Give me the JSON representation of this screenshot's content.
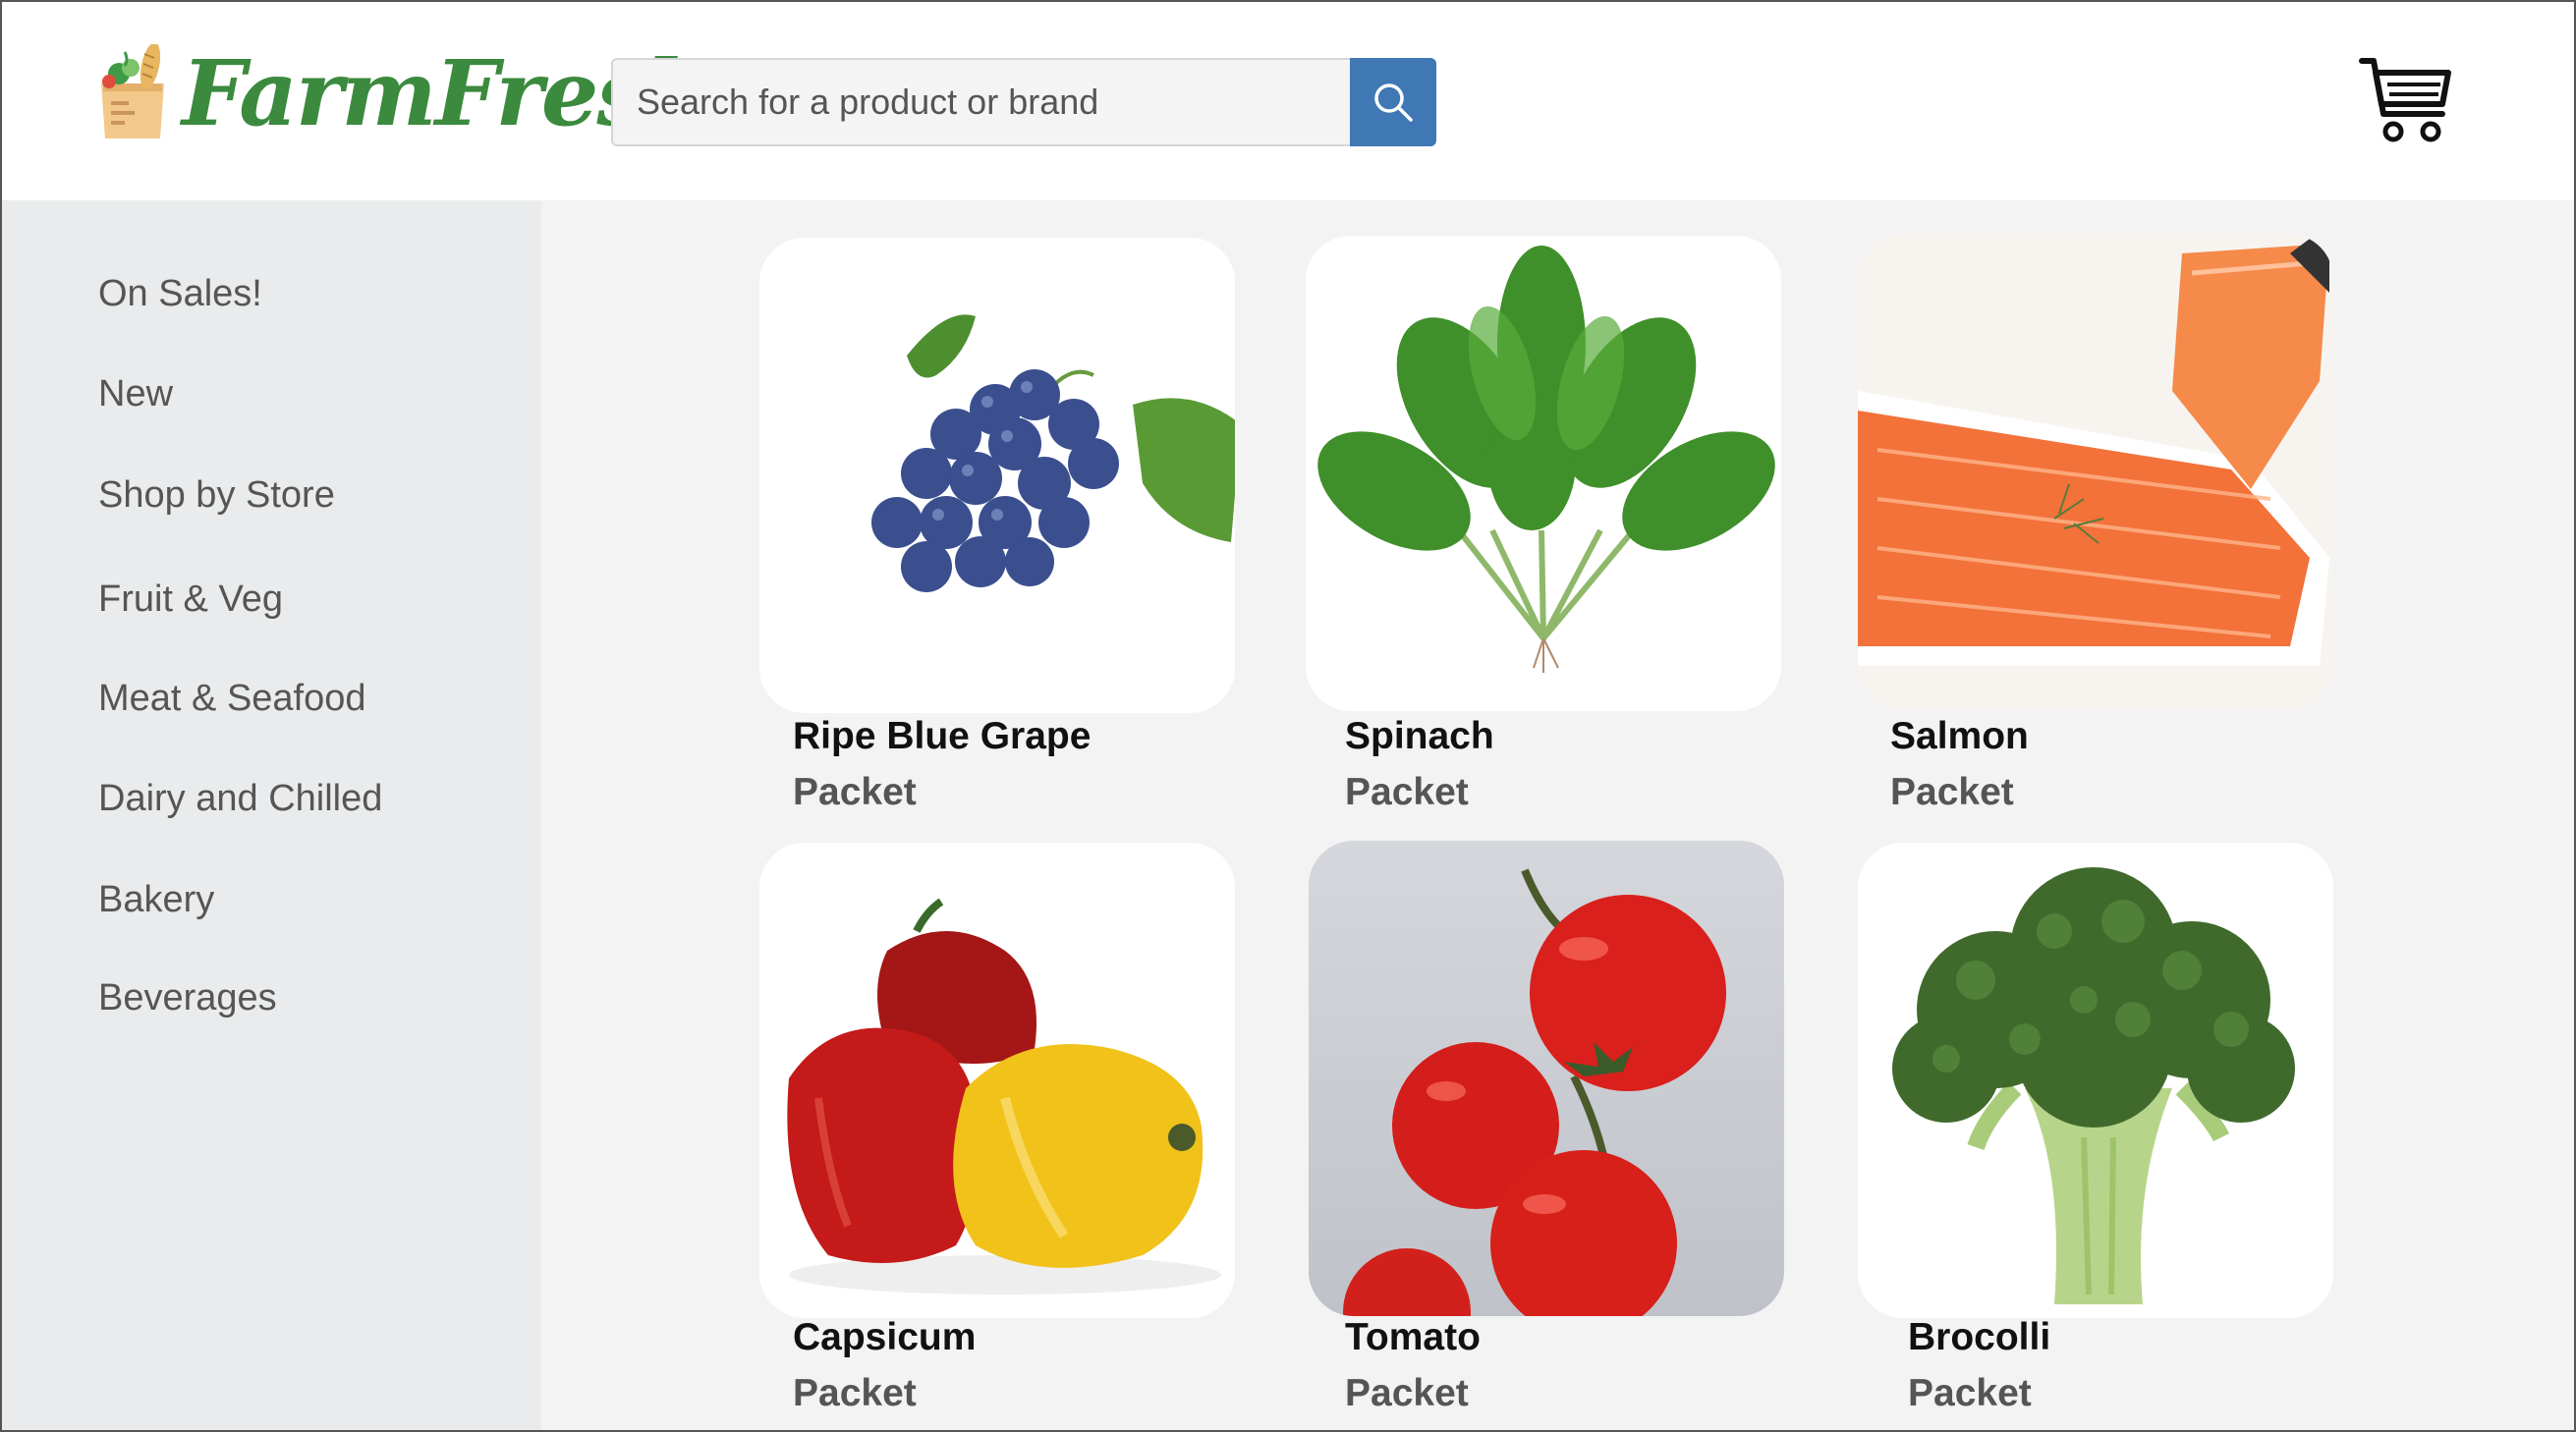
{
  "header": {
    "logo_text": "FarmFresh",
    "search": {
      "placeholder": "Search for a product or brand",
      "value": ""
    }
  },
  "sidebar": {
    "items": [
      {
        "label": "On Sales!"
      },
      {
        "label": "New"
      },
      {
        "label": "Shop by Store"
      },
      {
        "label": "Fruit & Veg"
      },
      {
        "label": "Meat & Seafood"
      },
      {
        "label": "Dairy and Chilled"
      },
      {
        "label": "Bakery"
      },
      {
        "label": "Beverages"
      }
    ]
  },
  "products": [
    {
      "name": "Ripe Blue Grape",
      "unit": "Packet",
      "image": "grape-image"
    },
    {
      "name": "Spinach",
      "unit": "Packet",
      "image": "spinach-image"
    },
    {
      "name": "Salmon",
      "unit": "Packet",
      "image": "salmon-image"
    },
    {
      "name": "Capsicum",
      "unit": "Packet",
      "image": "capsicum-image"
    },
    {
      "name": "Tomato",
      "unit": "Packet",
      "image": "tomato-image"
    },
    {
      "name": "Brocolli",
      "unit": "Packet",
      "image": "broccoli-image"
    }
  ],
  "colors": {
    "brand_green": "#3b8a3e",
    "search_button": "#3f78b5",
    "sidebar_bg": "#e9ebec",
    "page_bg": "#f3f3f3"
  }
}
